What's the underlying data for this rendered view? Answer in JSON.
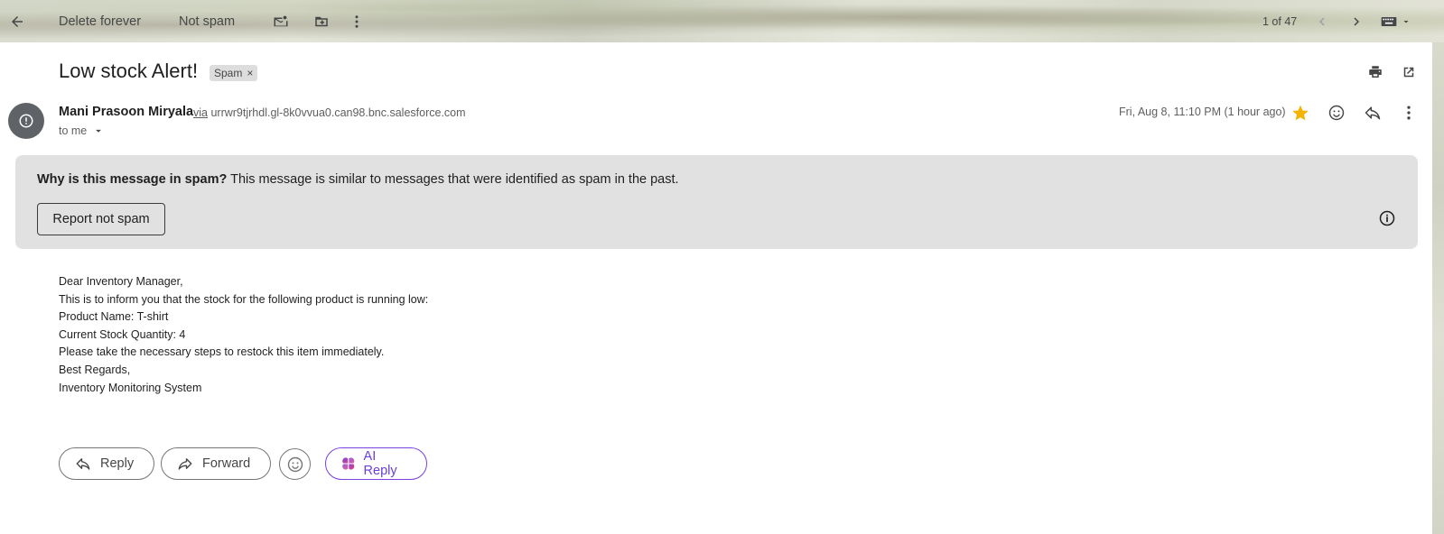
{
  "toolbar": {
    "delete_forever": "Delete forever",
    "not_spam": "Not spam",
    "pagination": "1 of 47"
  },
  "message": {
    "subject": "Low stock Alert!",
    "label_chip": "Spam",
    "sender_name": "Mani Prasoon Miryala",
    "via_word": "via",
    "via_domain": "urrwr9tjrhdl.gl-8k0vvua0.can98.bnc.salesforce.com",
    "recipient": "to me",
    "date": "Fri, Aug 8, 11:10 PM (1 hour ago)",
    "starred": true
  },
  "spam_banner": {
    "question": "Why is this message in spam?",
    "explanation": " This message is similar to messages that were identified as spam in the past.",
    "report_button": "Report not spam"
  },
  "body": {
    "lines": [
      "Dear Inventory Manager,",
      "This is to inform you that the stock for the following product is running low:",
      "Product Name: T-shirt",
      "Current Stock Quantity: 4",
      "Please take the necessary steps to restock this item immediately.",
      "Best Regards,",
      "Inventory Monitoring System"
    ]
  },
  "actions": {
    "reply": "Reply",
    "forward": "Forward",
    "ai_reply": "AI Reply"
  },
  "icons": {
    "back": "arrow-left-icon",
    "mark_unread": "mail-unread-icon",
    "move_to": "move-to-folder-icon",
    "more": "more-vert-icon",
    "prev": "chevron-left-icon",
    "next": "chevron-right-icon",
    "input_tools": "keyboard-icon",
    "print": "print-icon",
    "open_new_window": "open-in-new-icon",
    "star": "star-icon",
    "emoji": "emoji-icon",
    "reply": "reply-icon",
    "info": "info-icon"
  },
  "colors": {
    "star": "#f4b400",
    "ai_accent": "#6a3ed8",
    "banner_bg": "#e1e1e1",
    "avatar_bg": "#5f6368"
  }
}
